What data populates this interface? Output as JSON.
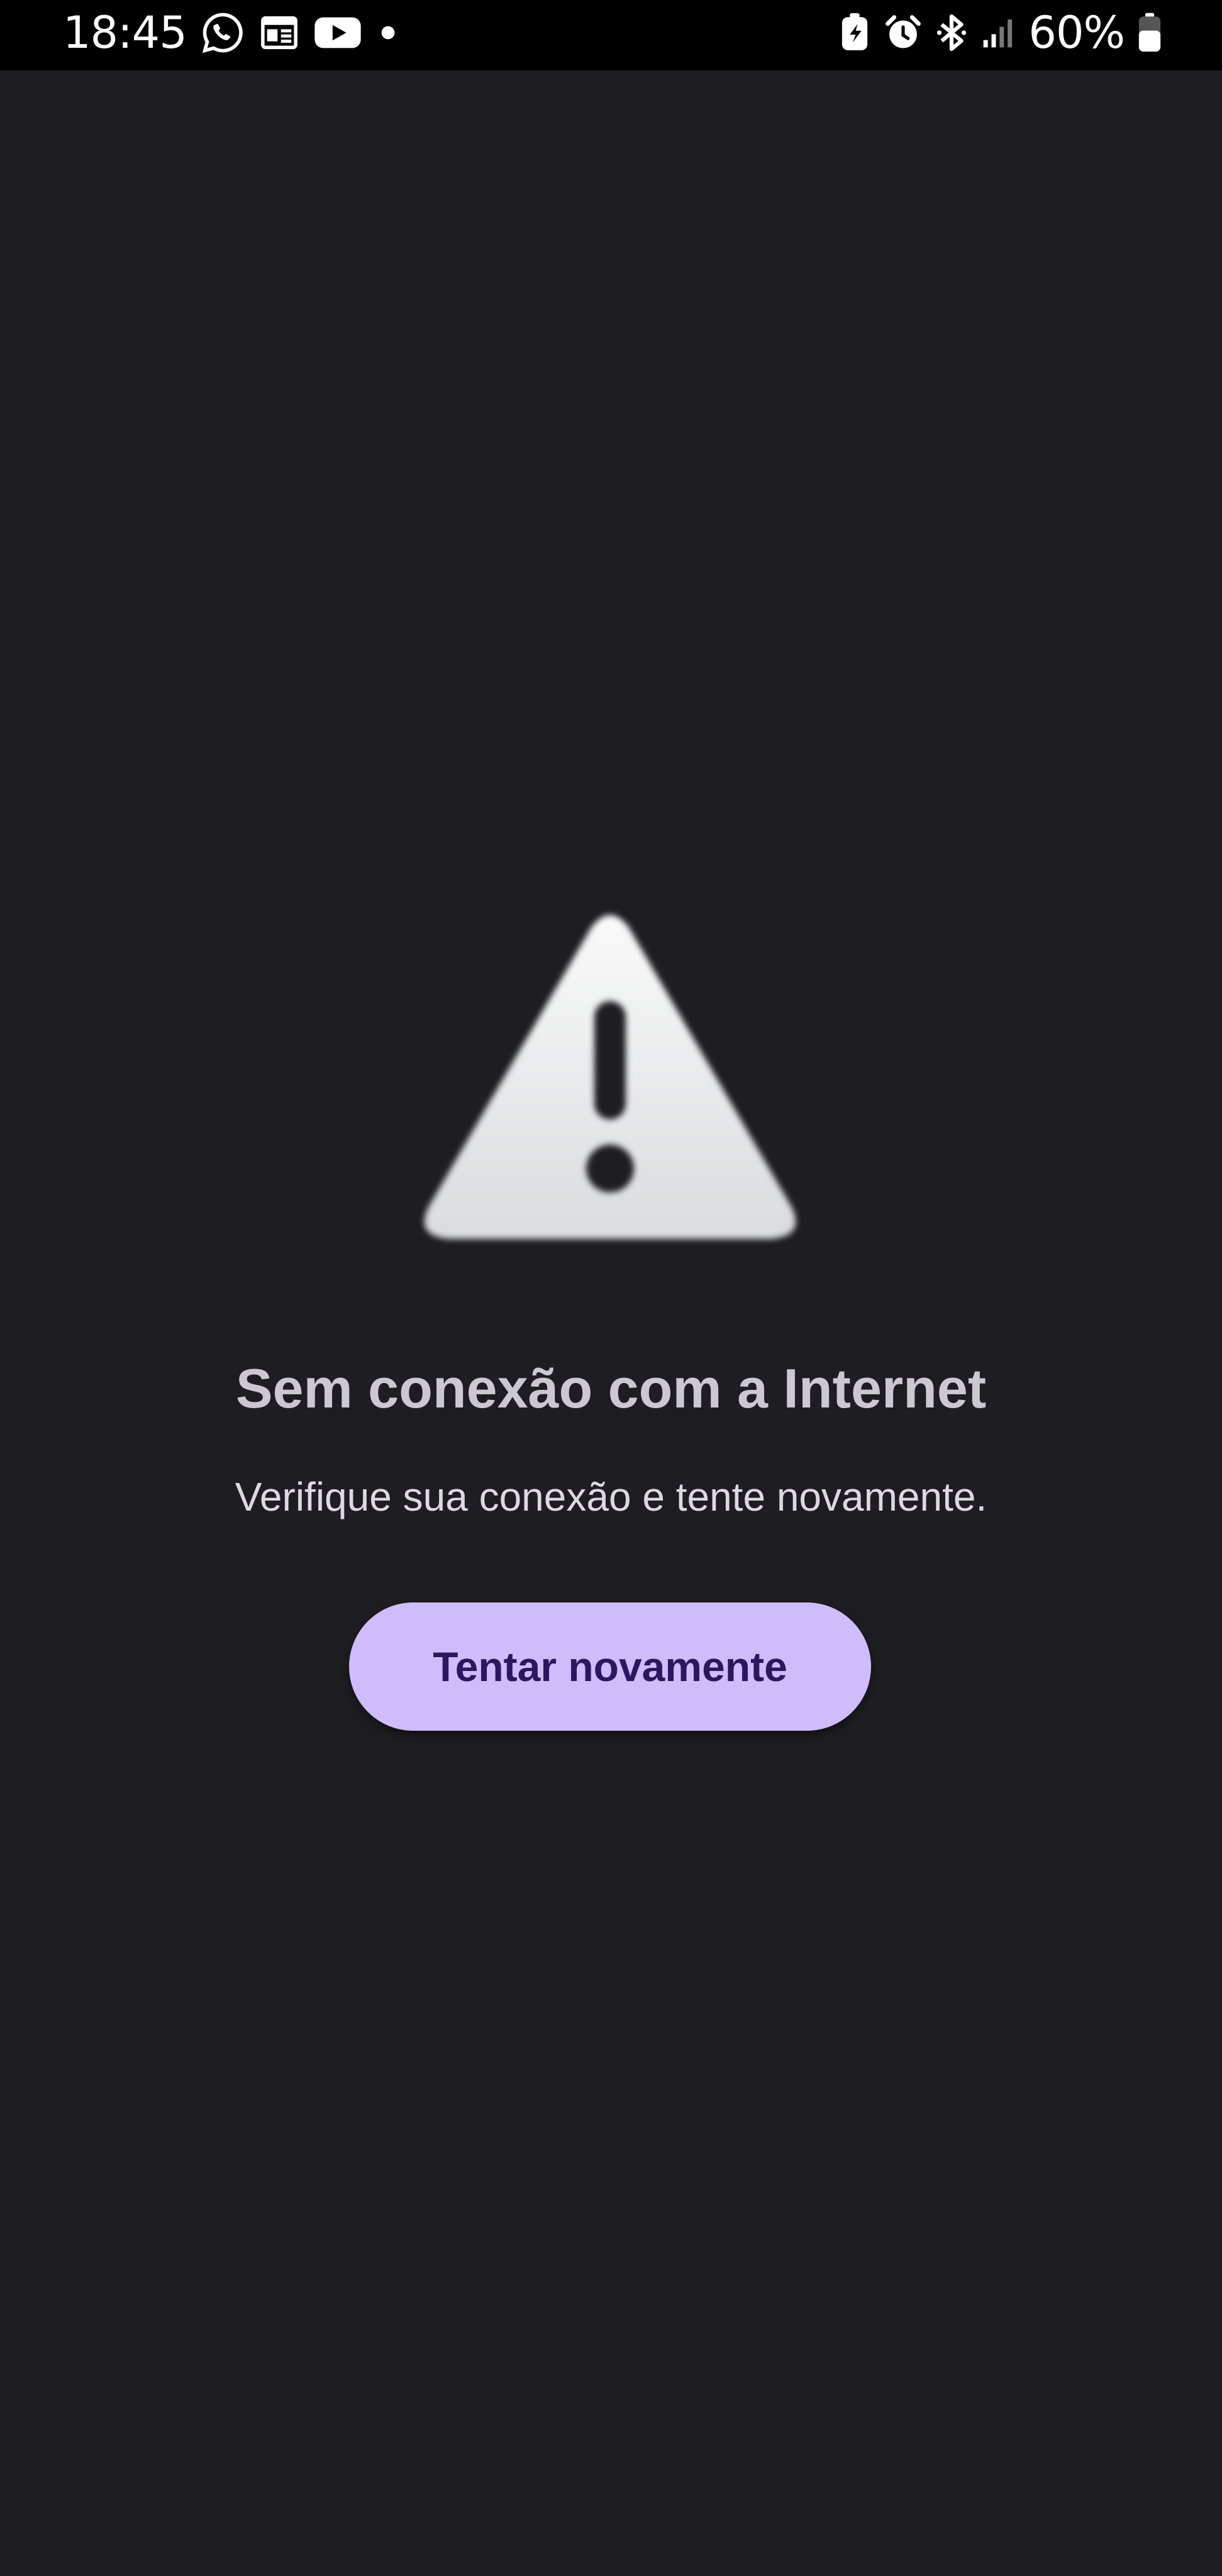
{
  "status_bar": {
    "time": "18:45",
    "notification_icons": [
      "whatsapp-icon",
      "news-icon",
      "youtube-icon",
      "dot-icon"
    ],
    "system_icons": [
      "battery-saver-icon",
      "alarm-icon",
      "bluetooth-icon",
      "signal-icon"
    ],
    "battery_percent": "60%",
    "battery_level": 0.6
  },
  "error": {
    "icon": "warning-icon",
    "title": "Sem conexão com a Internet",
    "message": "Verifique sua conexão e tente novamente.",
    "retry_label": "Tentar novamente"
  },
  "colors": {
    "background": "#1e1d22",
    "status_bar": "#000000",
    "title_text": "#cdc7d2",
    "message_text": "#ddd8e2",
    "button_fill": "#cfbcfb",
    "button_text": "#2a1860"
  }
}
